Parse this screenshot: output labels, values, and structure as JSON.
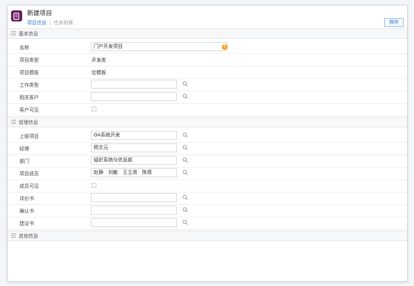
{
  "header": {
    "title": "新建项目",
    "tabs": [
      {
        "label": "项目信息",
        "active": true
      },
      {
        "label": "任务列表",
        "active": false
      }
    ],
    "save_label": "保存"
  },
  "sections": {
    "basic": "基本信息",
    "management": "管理信息",
    "other": "其他信息"
  },
  "fields": {
    "name": {
      "label": "名称",
      "value": "门户开发项目"
    },
    "project_type": {
      "label": "项目类型",
      "value": "开发类"
    },
    "project_template": {
      "label": "项目模板",
      "value": "空模板"
    },
    "work_type": {
      "label": "工作类型",
      "value": ""
    },
    "related_customer": {
      "label": "相关客户",
      "value": ""
    },
    "customer_visible": {
      "label": "客户可见",
      "checked": false
    },
    "parent_project": {
      "label": "上级项目",
      "value": "OA系统开发"
    },
    "manager": {
      "label": "经理",
      "value": "杨文元"
    },
    "department": {
      "label": "部门",
      "value": "组织系统与信息部"
    },
    "members": {
      "label": "项目成员",
      "value": "赵静　刘敏　王立贤　陈倩"
    },
    "member_visible": {
      "label": "成员可见",
      "checked": false
    },
    "evaluation": {
      "label": "评价书",
      "value": ""
    },
    "confirmation": {
      "label": "确认书",
      "value": ""
    },
    "proposal": {
      "label": "建议书",
      "value": ""
    }
  },
  "colors": {
    "accent": "#2d7bd4",
    "app_icon": "#6a1b5a",
    "warning": "#f0a21b"
  },
  "icons": {
    "app": "document-icon",
    "search": "search-icon",
    "warning": "warning-icon",
    "section": "menu-icon"
  }
}
